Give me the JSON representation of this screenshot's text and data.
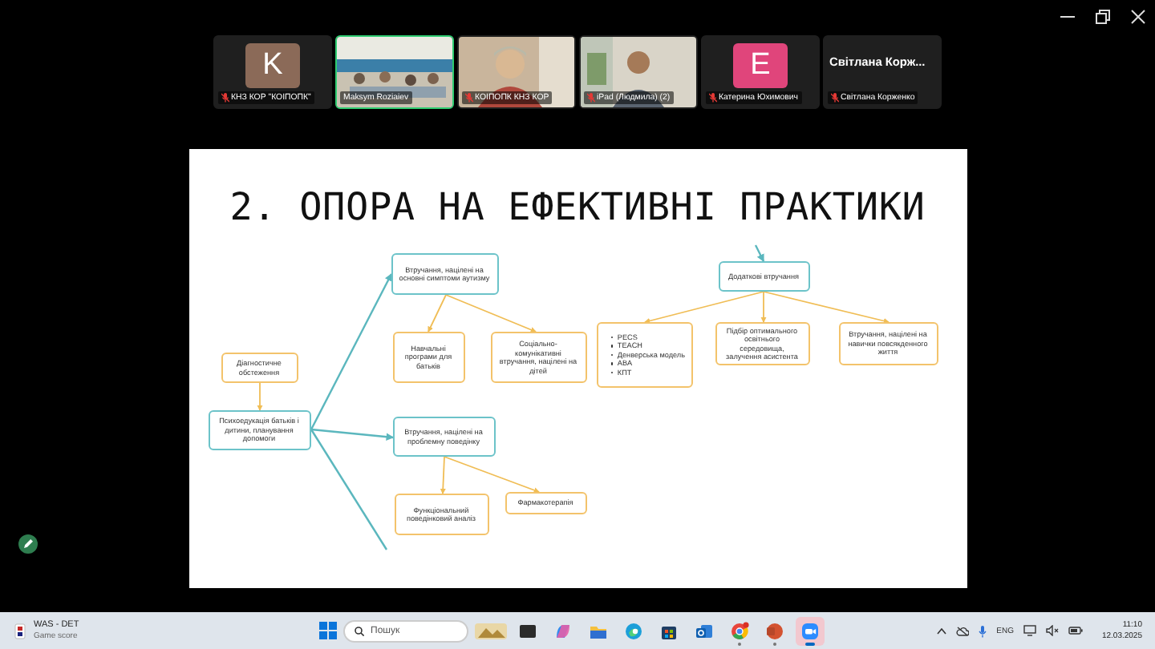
{
  "participants": [
    {
      "kind": "avatar",
      "initial": "K",
      "color": "#8b6a58",
      "name": "КНЗ КОР \"КОІПОПК\"",
      "muted": true,
      "speaking": false
    },
    {
      "kind": "video",
      "name": "Maksym Roziaiev",
      "muted": false,
      "speaking": true
    },
    {
      "kind": "video",
      "name": "КОІПОПК КНЗ КОР",
      "muted": true,
      "speaking": false
    },
    {
      "kind": "video",
      "name": "iPad (Людмила) (2)",
      "muted": true,
      "speaking": false
    },
    {
      "kind": "avatar",
      "initial": "E",
      "color": "#e0457b",
      "name": "Катерина Юхимович",
      "muted": true,
      "speaking": false
    },
    {
      "kind": "name",
      "display": "Світлана Корж...",
      "name": "Світлана Корженко",
      "muted": true,
      "speaking": false
    }
  ],
  "slide": {
    "title": "2. ОПОРА НА ЕФЕКТИВНІ ПРАКТИКИ",
    "nodes": [
      {
        "kind": "primary",
        "text": "Втручання, націлені на основні симптоми аутизму"
      },
      {
        "kind": "primary",
        "text": "Додаткові втручання"
      },
      {
        "kind": "secondary",
        "text": "Діагностичне обстеження"
      },
      {
        "kind": "secondary",
        "text": "Навчальні програми для батьків"
      },
      {
        "kind": "secondary",
        "text": "Соціально-комунікативні втручання, націлені на дітей"
      },
      {
        "kind": "list",
        "items": [
          "PECS",
          "TEACH",
          "Денверська модель",
          "ABA",
          "КПТ"
        ]
      },
      {
        "kind": "secondary",
        "text": "Підбір оптимального освітнього середовища, залучення асистента"
      },
      {
        "kind": "secondary",
        "text": "Втручання, націлені на навички повсякденного життя"
      },
      {
        "kind": "primary",
        "text": "Психоедукація батьків і дитини, планування допомоги"
      },
      {
        "kind": "primary",
        "text": "Втручання, націлені на проблемну поведінку"
      },
      {
        "kind": "secondary",
        "text": "Функціональний поведінковий аналіз"
      },
      {
        "kind": "secondary",
        "text": "Фармакотерапія"
      }
    ]
  },
  "taskbar": {
    "widget": {
      "title": "WAS - DET",
      "subtitle": "Game score"
    },
    "search": {
      "placeholder": "Пошук"
    },
    "apps": [
      {
        "kind": "dark",
        "running": false,
        "active": false
      },
      {
        "kind": "copilot",
        "running": false,
        "active": false
      },
      {
        "kind": "folder",
        "running": false,
        "active": false
      },
      {
        "kind": "edge",
        "running": false,
        "active": false
      },
      {
        "kind": "store",
        "running": false,
        "active": false
      },
      {
        "kind": "outlook",
        "running": false,
        "active": false
      },
      {
        "kind": "chrome",
        "running": true,
        "active": false
      },
      {
        "kind": "powerpoint",
        "running": true,
        "active": false
      },
      {
        "kind": "zoom",
        "running": true,
        "active": true
      }
    ],
    "language": "ENG",
    "time": "11:10",
    "date": "12.03.2025"
  }
}
